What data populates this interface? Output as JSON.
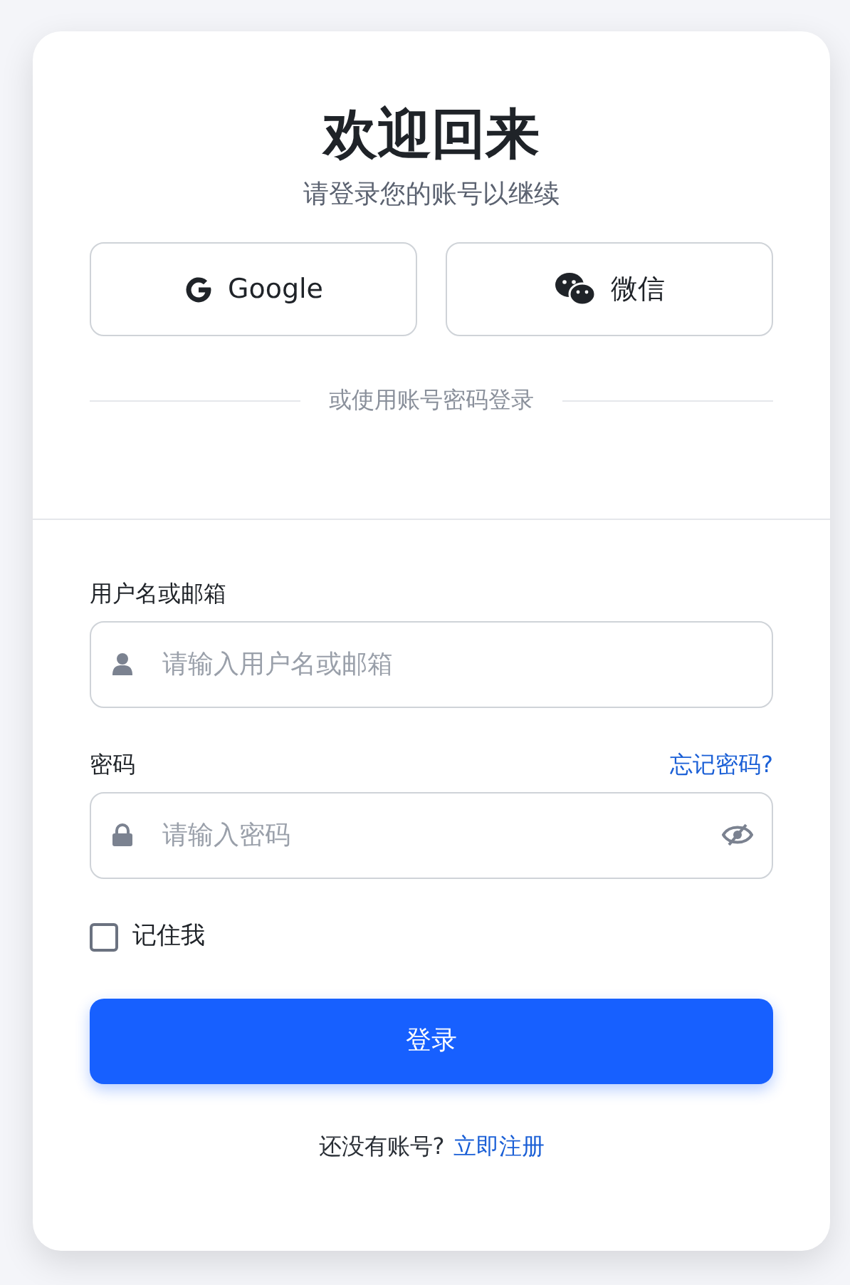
{
  "title": "欢迎回来",
  "subtitle": "请登录您的账号以继续",
  "social_buttons": [
    {
      "kind": "google",
      "label": "Google"
    },
    {
      "kind": "wechat",
      "label": "微信"
    }
  ],
  "divider_text": "或使用账号密码登录",
  "username": {
    "label": "用户名或邮箱",
    "placeholder": "请输入用户名或邮箱"
  },
  "password": {
    "label": "密码",
    "forgot_link": "忘记密码?",
    "placeholder": "请输入密码"
  },
  "remember_me": {
    "label": "记住我",
    "checked": false
  },
  "submit": "登录",
  "footer": {
    "text": "还没有账号?",
    "link": "立即注册"
  }
}
